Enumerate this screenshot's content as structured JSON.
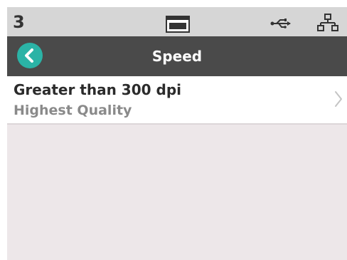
{
  "status_bar": {
    "number": "3",
    "icons": [
      "window-icon",
      "usb-icon",
      "network-icon"
    ]
  },
  "header": {
    "title": "Speed",
    "back_icon": "chevron-left-icon",
    "accent_color": "#2bb3a6"
  },
  "list": {
    "items": [
      {
        "primary": "Greater than 300 dpi",
        "secondary": "Highest Quality",
        "icon": "chevron-right-icon"
      }
    ]
  }
}
